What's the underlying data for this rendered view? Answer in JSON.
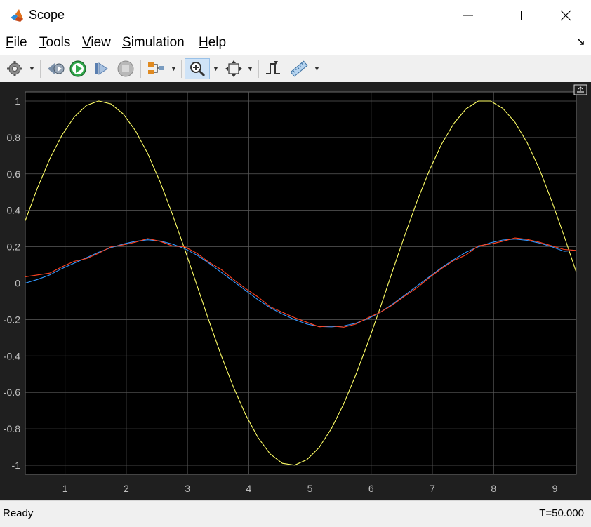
{
  "window": {
    "title": "Scope",
    "controls": {
      "minimize": "—",
      "maximize": "☐",
      "close": "✕"
    }
  },
  "menu": {
    "items": [
      {
        "label": "File",
        "mnemonic": "F",
        "rest": "ile"
      },
      {
        "label": "Tools",
        "mnemonic": "T",
        "rest": "ools"
      },
      {
        "label": "View",
        "mnemonic": "V",
        "rest": "iew"
      },
      {
        "label": "Simulation",
        "mnemonic": "S",
        "rest": "imulation"
      },
      {
        "label": "Help",
        "mnemonic": "H",
        "rest": "elp"
      }
    ],
    "undock_icon": "undock-arrow-icon"
  },
  "toolbar": {
    "buttons": [
      {
        "name": "settings-icon"
      },
      {
        "name": "step-back-icon"
      },
      {
        "name": "run-icon"
      },
      {
        "name": "step-forward-icon"
      },
      {
        "name": "stop-icon"
      },
      {
        "name": "signal-selection-icon"
      },
      {
        "name": "zoom-in-icon",
        "active": true
      },
      {
        "name": "autoscale-icon"
      },
      {
        "name": "triggers-icon"
      },
      {
        "name": "measurements-icon"
      }
    ]
  },
  "status": {
    "text": "Ready",
    "time": "T=50.000"
  },
  "colors": {
    "plot_bg": "#000000",
    "frame_bg": "#1f1f1f",
    "grid": "#5a5a5a",
    "tick_text": "#bfbfbf",
    "yellow": "#ffff66",
    "blue": "#3399ff",
    "red": "#ff4422",
    "green": "#66dd44"
  },
  "chart_data": {
    "type": "line",
    "xlim": [
      0.35,
      9.35
    ],
    "ylim": [
      -1.05,
      1.05
    ],
    "xticks": [
      "1",
      "2",
      "3",
      "4",
      "5",
      "6",
      "7",
      "8",
      "9"
    ],
    "yticks": [
      "1",
      "0.8",
      "0.6",
      "0.4",
      "0.2",
      "0",
      "-0.2",
      "-0.4",
      "-0.6",
      "-0.8",
      "-1"
    ],
    "grid": true,
    "series": [
      {
        "color": "yellow",
        "x": [
          0.35,
          0.55,
          0.75,
          0.95,
          1.15,
          1.35,
          1.55,
          1.75,
          1.95,
          2.15,
          2.35,
          2.55,
          2.75,
          2.95,
          3.15,
          3.35,
          3.55,
          3.75,
          3.95,
          4.15,
          4.35,
          4.55,
          4.75,
          4.95,
          5.15,
          5.35,
          5.55,
          5.75,
          5.95,
          6.15,
          6.35,
          6.55,
          6.75,
          6.95,
          7.15,
          7.35,
          7.55,
          7.75,
          7.95,
          8.15,
          8.35,
          8.55,
          8.75,
          8.95,
          9.15,
          9.35
        ],
        "y": [
          0.343,
          0.523,
          0.682,
          0.813,
          0.913,
          0.976,
          1.0,
          0.984,
          0.929,
          0.837,
          0.712,
          0.558,
          0.382,
          0.191,
          -0.008,
          -0.207,
          -0.397,
          -0.571,
          -0.723,
          -0.847,
          -0.938,
          -0.989,
          -0.999,
          -0.969,
          -0.902,
          -0.799,
          -0.664,
          -0.503,
          -0.324,
          -0.133,
          0.067,
          0.264,
          0.45,
          0.619,
          0.763,
          0.877,
          0.957,
          1.0,
          1.0,
          0.96,
          0.883,
          0.77,
          0.625,
          0.45,
          0.26,
          0.06
        ]
      },
      {
        "color": "blue",
        "x": [
          0.35,
          0.55,
          0.75,
          0.95,
          1.15,
          1.35,
          1.55,
          1.75,
          1.95,
          2.15,
          2.35,
          2.55,
          2.75,
          2.95,
          3.15,
          3.35,
          3.55,
          3.75,
          3.95,
          4.15,
          4.35,
          4.55,
          4.75,
          4.95,
          5.15,
          5.35,
          5.55,
          5.75,
          5.95,
          6.15,
          6.35,
          6.55,
          6.75,
          6.95,
          7.15,
          7.35,
          7.55,
          7.75,
          7.95,
          8.15,
          8.35,
          8.55,
          8.75,
          8.95,
          9.15,
          9.35
        ],
        "y": [
          0.0,
          0.02,
          0.045,
          0.08,
          0.11,
          0.14,
          0.17,
          0.195,
          0.215,
          0.23,
          0.238,
          0.232,
          0.215,
          0.19,
          0.155,
          0.11,
          0.06,
          0.01,
          -0.04,
          -0.09,
          -0.135,
          -0.17,
          -0.2,
          -0.225,
          -0.238,
          -0.24,
          -0.235,
          -0.22,
          -0.195,
          -0.16,
          -0.115,
          -0.065,
          -0.015,
          0.035,
          0.085,
          0.13,
          0.17,
          0.2,
          0.222,
          0.237,
          0.242,
          0.235,
          0.22,
          0.2,
          0.175,
          0.18
        ]
      },
      {
        "color": "red",
        "x": [
          0.35,
          0.55,
          0.75,
          0.95,
          1.15,
          1.35,
          1.55,
          1.75,
          1.95,
          2.15,
          2.35,
          2.55,
          2.75,
          2.95,
          3.15,
          3.35,
          3.55,
          3.75,
          3.95,
          4.15,
          4.35,
          4.55,
          4.75,
          4.95,
          5.15,
          5.35,
          5.55,
          5.75,
          5.95,
          6.15,
          6.35,
          6.55,
          6.75,
          6.95,
          7.15,
          7.35,
          7.55,
          7.75,
          7.95,
          8.15,
          8.35,
          8.55,
          8.75,
          8.95,
          9.15,
          9.35
        ],
        "y": [
          0.035,
          0.045,
          0.055,
          0.09,
          0.12,
          0.135,
          0.165,
          0.2,
          0.21,
          0.225,
          0.245,
          0.23,
          0.205,
          0.2,
          0.165,
          0.115,
          0.075,
          0.02,
          -0.03,
          -0.075,
          -0.13,
          -0.16,
          -0.19,
          -0.215,
          -0.24,
          -0.235,
          -0.242,
          -0.225,
          -0.19,
          -0.16,
          -0.12,
          -0.07,
          -0.025,
          0.03,
          0.08,
          0.125,
          0.155,
          0.205,
          0.215,
          0.23,
          0.248,
          0.24,
          0.225,
          0.205,
          0.185,
          0.18
        ]
      },
      {
        "color": "green",
        "x": [
          0.35,
          9.35
        ],
        "y": [
          0.0,
          0.0
        ]
      }
    ]
  }
}
